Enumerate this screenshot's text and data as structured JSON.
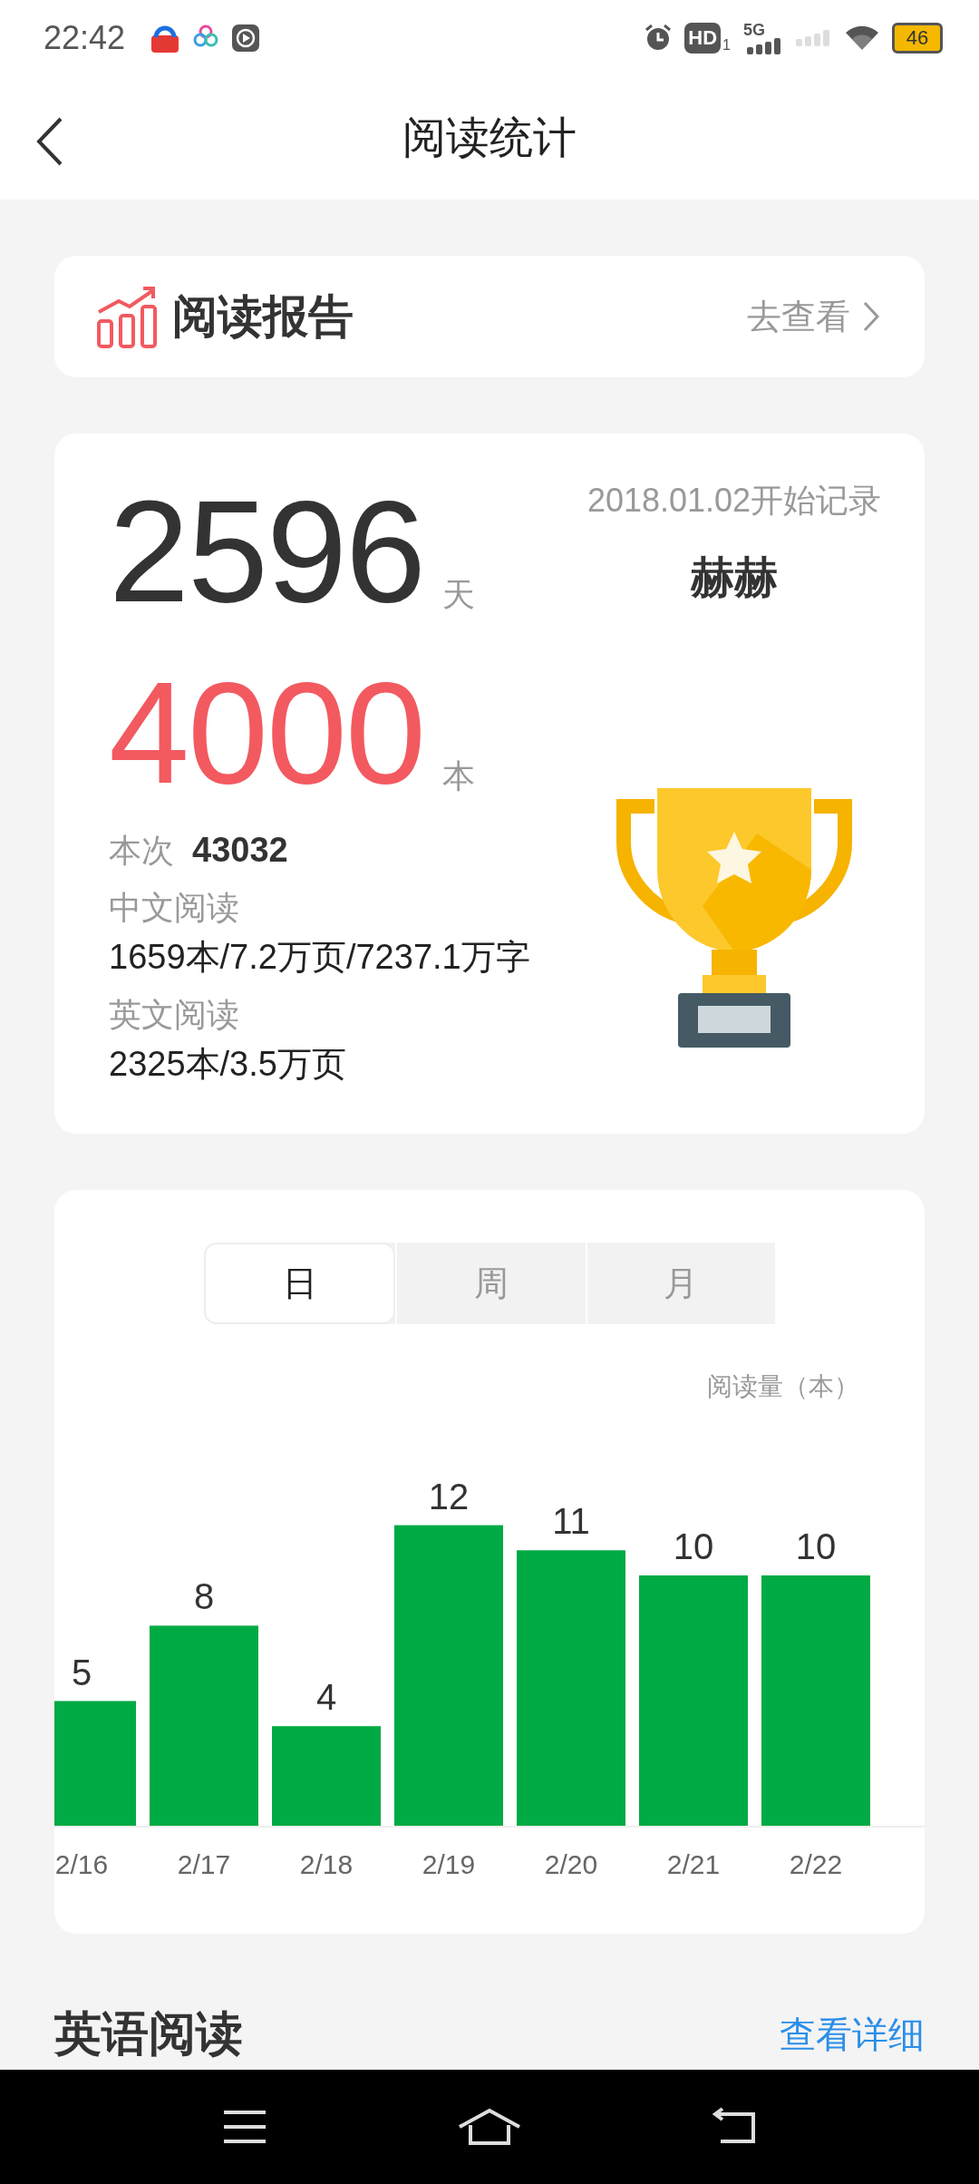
{
  "status_bar": {
    "time": "22:42",
    "hd_label": "HD",
    "hd_sub": "1",
    "network": "5G",
    "battery": "46"
  },
  "header": {
    "title": "阅读统计"
  },
  "report_card": {
    "title": "阅读报告",
    "link": "去查看"
  },
  "summary": {
    "days": "2596",
    "days_unit": "天",
    "books": "4000",
    "books_unit": "本",
    "start_date": "2018.01.02开始记录",
    "name": "赫赫",
    "count_label": "本次",
    "count": "43032",
    "chinese_label": "中文阅读",
    "chinese_value": "1659本/7.2万页/7237.1万字",
    "english_label": "英文阅读",
    "english_value": "2325本/3.5万页"
  },
  "period_tabs": [
    {
      "label": "日",
      "selected": true
    },
    {
      "label": "周",
      "selected": false
    },
    {
      "label": "月",
      "selected": false
    }
  ],
  "chart": {
    "unit_label": "阅读量（本）",
    "chart_data": {
      "type": "bar",
      "categories": [
        "2/16",
        "2/17",
        "2/18",
        "2/19",
        "2/20",
        "2/21",
        "2/22"
      ],
      "series": [
        {
          "color": "#00aa44",
          "values": [
            5,
            8,
            4,
            12,
            11,
            10,
            10
          ]
        }
      ],
      "data_labels": true
    }
  },
  "english_section": {
    "title": "英语阅读",
    "link": "查看详细"
  }
}
